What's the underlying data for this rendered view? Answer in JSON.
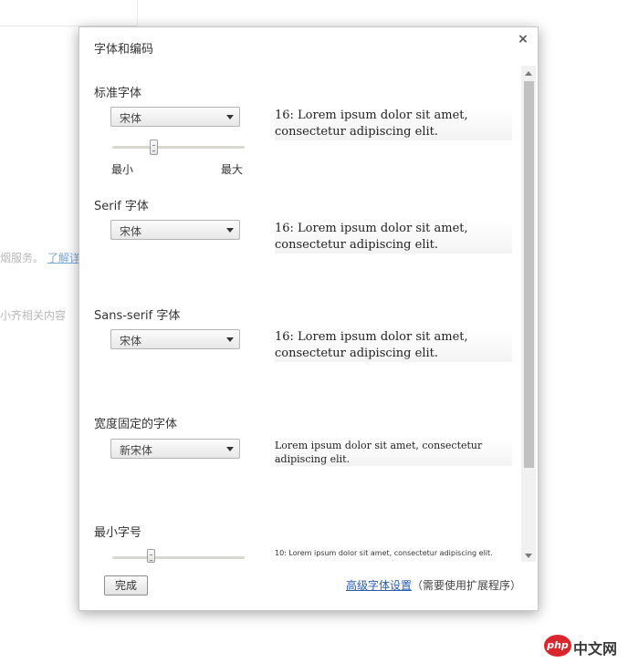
{
  "background": {
    "text_line_1_prefix": "烟服务。",
    "text_line_1_link": "了解详",
    "text_line_2": "小齐相关内容"
  },
  "dialog": {
    "title": "字体和编码",
    "close_glyph": "×",
    "sections": {
      "standard": {
        "label": "标准字体",
        "font_value": "宋体",
        "preview": "16: Lorem ipsum dolor sit amet, consectetur adipiscing elit.",
        "slider_min": "最小",
        "slider_max": "最大",
        "slider_level": 0.3
      },
      "serif": {
        "label": "Serif 字体",
        "font_value": "宋体",
        "preview": "16: Lorem ipsum dolor sit amet, consectetur adipiscing elit."
      },
      "sans_serif": {
        "label": "Sans-serif 字体",
        "font_value": "宋体",
        "preview": "16: Lorem ipsum dolor sit amet, consectetur adipiscing elit."
      },
      "fixed": {
        "label": "宽度固定的字体",
        "font_value": "新宋体",
        "preview": "Lorem ipsum dolor sit amet, consectetur adipiscing elit."
      },
      "minimum": {
        "label": "最小字号",
        "preview": "10: Lorem ipsum dolor sit amet, consectetur adipiscing elit.",
        "slider_level": 0.28
      }
    },
    "footer": {
      "done_label": "完成",
      "advanced_link": "高级字体设置",
      "advanced_note": "（需要使用扩展程序）"
    }
  },
  "watermark": {
    "badge": "php",
    "text": "中文网"
  },
  "colors": {
    "link": "#2a5db0",
    "scroll_thumb": "#c1c1c1",
    "dialog_border": "#c8c8c8"
  }
}
